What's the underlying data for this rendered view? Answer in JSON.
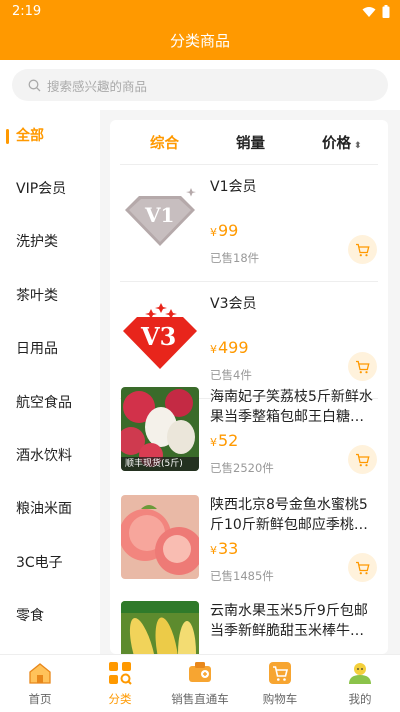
{
  "status": {
    "time": "2:19"
  },
  "header": {
    "title": "分类商品"
  },
  "search": {
    "placeholder": "搜索感兴趣的商品"
  },
  "sidebar": {
    "items": [
      {
        "label": "全部",
        "active": true
      },
      {
        "label": "VIP会员"
      },
      {
        "label": "洗护类"
      },
      {
        "label": "茶叶类"
      },
      {
        "label": "日用品"
      },
      {
        "label": "航空食品"
      },
      {
        "label": "酒水饮料"
      },
      {
        "label": "粮油米面"
      },
      {
        "label": "3C电子"
      },
      {
        "label": "零食"
      }
    ]
  },
  "sort": {
    "comprehensive": "综合",
    "sales": "销量",
    "price": "价格"
  },
  "products": [
    {
      "name": "V1会员",
      "currency": "¥",
      "price": "99",
      "sold": "已售18件",
      "image": "v1-badge-image"
    },
    {
      "name": "V3会员",
      "currency": "¥",
      "price": "499",
      "sold": "已售4件",
      "image": "v3-badge-image"
    },
    {
      "name": "海南妃子笑荔枝5斤新鲜水果当季整箱包邮王白糖…",
      "currency": "¥",
      "price": "52",
      "sold": "已售2520件",
      "image": "lychee-image",
      "image_text": "顺丰现货(5斤)"
    },
    {
      "name": "陕西北京8号金鱼水蜜桃5斤10斤新鲜包邮应季桃…",
      "currency": "¥",
      "price": "33",
      "sold": "已售1485件",
      "image": "peach-image"
    },
    {
      "name": "云南水果玉米5斤9斤包邮当季新鲜脆甜玉米棒牛…",
      "currency": "¥",
      "price": "",
      "sold": "",
      "image": "corn-image"
    }
  ],
  "tabbar": {
    "items": [
      {
        "label": "首页",
        "icon": "home-icon"
      },
      {
        "label": "分类",
        "icon": "category-icon",
        "active": true
      },
      {
        "label": "销售直通车",
        "icon": "sales-icon"
      },
      {
        "label": "购物车",
        "icon": "cart-icon"
      },
      {
        "label": "我的",
        "icon": "profile-icon"
      }
    ]
  },
  "colors": {
    "accent": "#ff9900",
    "badge_red": "#e8251b",
    "badge_silver": "#b5a9aa"
  }
}
